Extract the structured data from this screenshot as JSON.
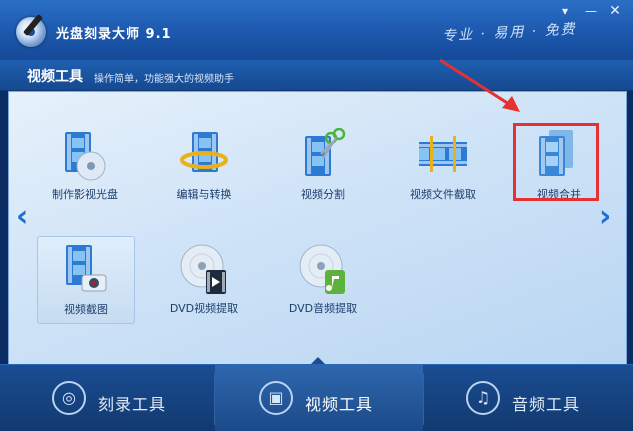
{
  "app": {
    "title": "光盘刻录大师 9.1",
    "slogan": "专业 · 易用 · 免费"
  },
  "window_controls": {
    "menu": "▾",
    "minimize": "—",
    "close": "✕"
  },
  "subheader": {
    "title": "视频工具",
    "description": "操作简单，功能强大的视频助手"
  },
  "nav": {
    "prev": "‹",
    "next": "›"
  },
  "tools": [
    {
      "label": "制作影视光盘",
      "icon": "film-disc-icon"
    },
    {
      "label": "编辑与转换",
      "icon": "film-ring-icon"
    },
    {
      "label": "视频分割",
      "icon": "film-scissors-icon"
    },
    {
      "label": "视频文件截取",
      "icon": "film-strip-icon"
    },
    {
      "label": "视频合并",
      "icon": "film-merge-icon"
    },
    {
      "label": "视频截图",
      "icon": "film-camera-icon"
    },
    {
      "label": "DVD视频提取",
      "icon": "disc-video-icon"
    },
    {
      "label": "DVD音频提取",
      "icon": "disc-music-icon"
    }
  ],
  "bottom_tabs": [
    {
      "label": "刻录工具",
      "icon": "disc-icon",
      "active": false
    },
    {
      "label": "视频工具",
      "icon": "film-icon",
      "active": true
    },
    {
      "label": "音频工具",
      "icon": "music-note-icon",
      "active": false
    }
  ],
  "colors": {
    "accent": "#1e6fd0",
    "highlight": "#e53131",
    "titlebar": "#1c58ae"
  }
}
